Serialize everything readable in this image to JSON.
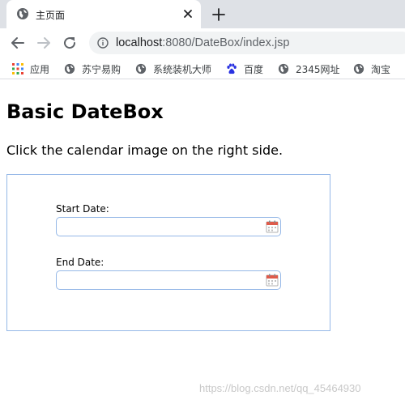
{
  "browser": {
    "tab": {
      "title": "主页面"
    },
    "address": {
      "host": "localhost",
      "rest": ":8080/DateBox/index.jsp"
    },
    "bookmarks": [
      {
        "label": "应用",
        "icon": "apps-grid-icon"
      },
      {
        "label": "苏宁易购",
        "icon": "globe-icon"
      },
      {
        "label": "系统装机大师",
        "icon": "globe-icon"
      },
      {
        "label": "百度",
        "icon": "baidu-paw-icon"
      },
      {
        "label": "2345网址",
        "icon": "globe-icon"
      },
      {
        "label": "淘宝",
        "icon": "globe-icon"
      }
    ]
  },
  "page": {
    "title": "Basic DateBox",
    "description": "Click the calendar image on the right side.",
    "start_date": {
      "label": "Start Date:",
      "value": ""
    },
    "end_date": {
      "label": "End Date:",
      "value": ""
    }
  },
  "watermark": "https://blog.csdn.net/qq_45464930",
  "colors": {
    "panel_border": "#95b8e7",
    "tabstrip_bg": "#dee1e6",
    "omnibox_bg": "#f1f3f4"
  }
}
